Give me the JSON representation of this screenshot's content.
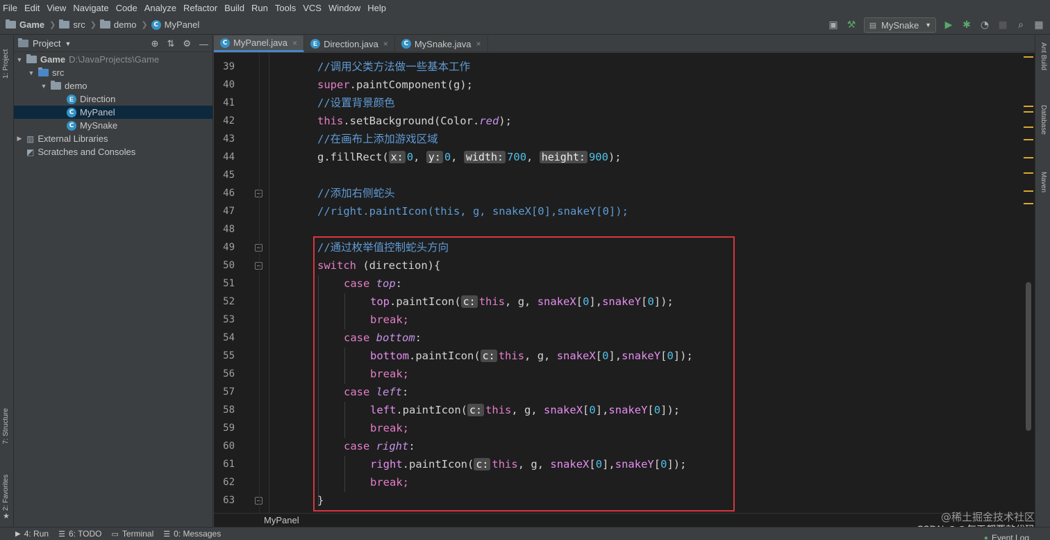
{
  "menu": [
    "File",
    "Edit",
    "View",
    "Navigate",
    "Code",
    "Analyze",
    "Refactor",
    "Build",
    "Run",
    "Tools",
    "VCS",
    "Window",
    "Help"
  ],
  "breadcrumb": [
    "Game",
    "src",
    "demo",
    "MyPanel"
  ],
  "run_config": "MySnake",
  "project_panel": {
    "title": "Project",
    "tree": {
      "root": "Game",
      "root_path": "D:\\JavaProjects\\Game",
      "src": "src",
      "demo": "demo",
      "classes": [
        "Direction",
        "MyPanel",
        "MySnake"
      ],
      "external": "External Libraries",
      "scratches": "Scratches and Consoles"
    }
  },
  "tabs": [
    "MyPanel.java",
    "Direction.java",
    "MySnake.java"
  ],
  "side_strips": {
    "left": [
      "1: Project",
      "7: Structure",
      "2: Favorites"
    ],
    "right": [
      "Ant Build",
      "Database",
      "Maven"
    ]
  },
  "code": {
    "line_numbers": [
      "39",
      "40",
      "41",
      "42",
      "43",
      "44",
      "45",
      "46",
      "47",
      "48",
      "49",
      "50",
      "51",
      "52",
      "53",
      "54",
      "55",
      "56",
      "57",
      "58",
      "59",
      "60",
      "61",
      "62",
      "63"
    ],
    "l39": "//调用父类方法做一些基本工作",
    "l40_kw": "super",
    "l40_rest": ".paintComponent(g);",
    "l41": "//设置背景颜色",
    "l42_kw": "this",
    "l42_mid": ".setBackground(Color.",
    "l42_it": "red",
    "l42_end": ");",
    "l43": "//在画布上添加游戏区域",
    "l44_a": "g.fillRect(",
    "l44_h1": "x:",
    "l44_n1": "0",
    "l44_h2": "y:",
    "l44_n2": "0",
    "l44_h3": "width:",
    "l44_n3": "700",
    "l44_h4": "height:",
    "l44_n4": "900",
    "l44_end": ");",
    "l46": "//添加右侧蛇头",
    "l47": "//right.paintIcon(this, g, snakeX[0],snakeY[0]);",
    "l49": "//通过枚举值控制蛇头方向",
    "l50_kw": "switch",
    "l50_rest": " (direction){",
    "case_kw": "case",
    "case_top": "top",
    "case_bottom": "bottom",
    "case_left": "left",
    "case_right": "right",
    "colon": ":",
    "call_paint": ".paintIcon(",
    "hint_c": "c:",
    "this_kw": "this",
    "args_g": ", g, ",
    "snakeX": "snakeX",
    "snakeY": "snakeY",
    "idx_open": "[",
    "idx_zero": "0",
    "idx_close": "]",
    "comma": ",",
    "call_end": ");",
    "break": "break;",
    "close_brace": "}"
  },
  "editor_breadcrumb": "MyPanel",
  "status_bar": [
    "4: Run",
    "6: TODO",
    "Terminal",
    "0: Messages"
  ],
  "event_log": "Event Log",
  "watermarks": [
    "@稀土掘金技术社区",
    "CSDN @@每天都要敲代码"
  ],
  "colors": {
    "highlight_box": "#d9363e",
    "comment": "#5f9bd5",
    "keyword": "#e57ec8",
    "number": "#4fc1e9"
  }
}
